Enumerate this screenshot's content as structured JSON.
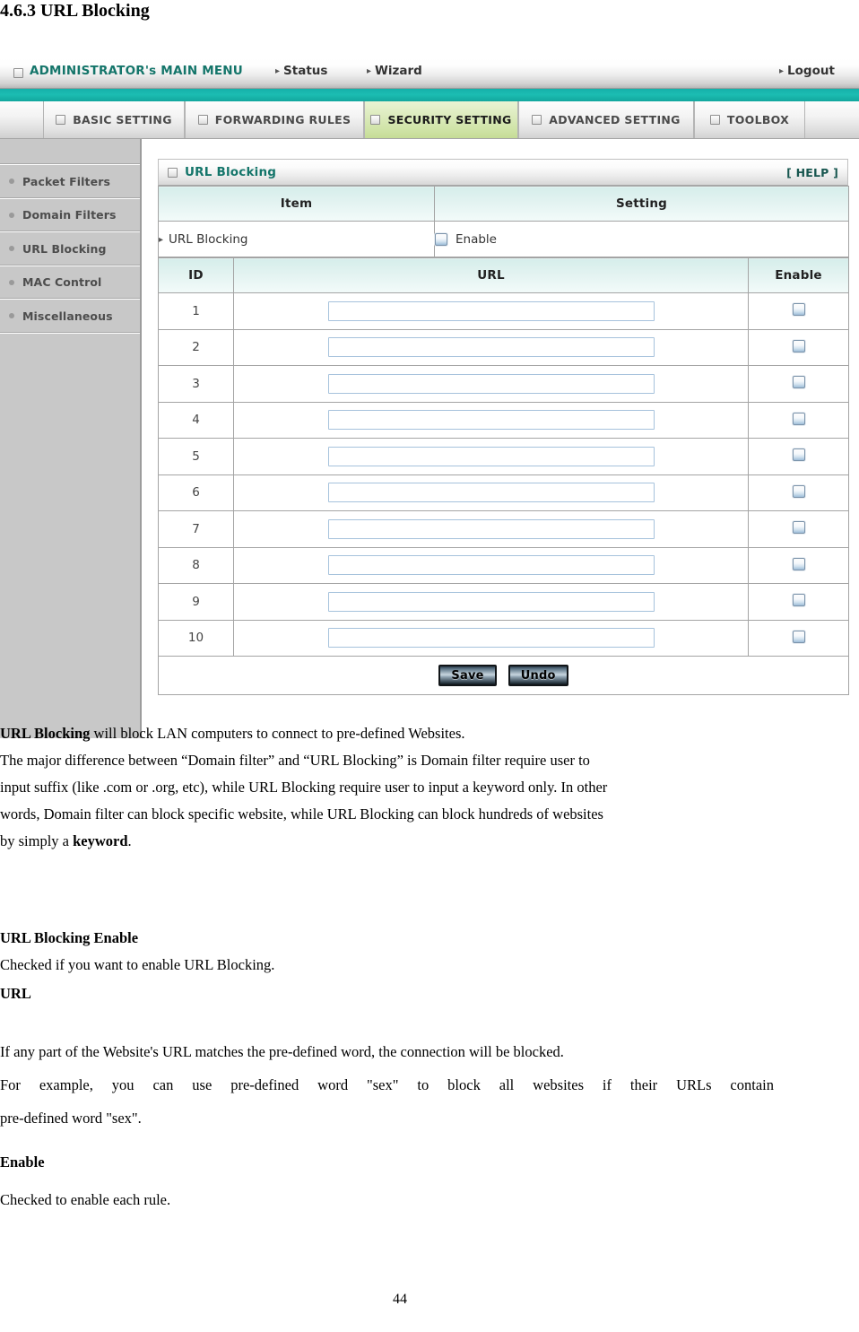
{
  "document": {
    "heading": "4.6.3 URL Blocking",
    "page_number": "44"
  },
  "router_ui": {
    "top_menu": {
      "main_menu_label": "ADMINISTRATOR's MAIN MENU",
      "links": [
        {
          "label": "Status"
        },
        {
          "label": "Wizard"
        },
        {
          "label": "Logout"
        }
      ]
    },
    "tabs": [
      {
        "label": "BASIC SETTING",
        "active": false
      },
      {
        "label": "FORWARDING RULES",
        "active": false
      },
      {
        "label": "SECURITY SETTING",
        "active": true
      },
      {
        "label": "ADVANCED SETTING",
        "active": false
      },
      {
        "label": "TOOLBOX",
        "active": false
      }
    ],
    "sidebar": {
      "items": [
        {
          "label": "Packet Filters"
        },
        {
          "label": "Domain Filters"
        },
        {
          "label": "URL Blocking"
        },
        {
          "label": "MAC Control"
        },
        {
          "label": "Miscellaneous"
        }
      ]
    },
    "panel": {
      "title": "URL Blocking",
      "help_label": "[ HELP ]",
      "columns": {
        "item": "Item",
        "setting": "Setting"
      },
      "enable_row": {
        "item_label": "URL Blocking",
        "checkbox_label": "Enable",
        "checked": false
      },
      "table_headers": {
        "id": "ID",
        "url": "URL",
        "enable": "Enable"
      },
      "rows": [
        {
          "id": "1",
          "url": "",
          "enabled": false
        },
        {
          "id": "2",
          "url": "",
          "enabled": false
        },
        {
          "id": "3",
          "url": "",
          "enabled": false
        },
        {
          "id": "4",
          "url": "",
          "enabled": false
        },
        {
          "id": "5",
          "url": "",
          "enabled": false
        },
        {
          "id": "6",
          "url": "",
          "enabled": false
        },
        {
          "id": "7",
          "url": "",
          "enabled": false
        },
        {
          "id": "8",
          "url": "",
          "enabled": false
        },
        {
          "id": "9",
          "url": "",
          "enabled": false
        },
        {
          "id": "10",
          "url": "",
          "enabled": false
        }
      ],
      "buttons": {
        "save": "Save",
        "undo": "Undo"
      }
    },
    "colors": {
      "teal_bar": "#18b3ab",
      "heading_teal": "#14756a",
      "active_tab_green": "#d4e8ad",
      "table_header_mint": "#e3f3f1",
      "input_border_blue": "#a6c2dc",
      "sidebar_gray": "#c8c8c8"
    }
  },
  "body_text": {
    "intro": {
      "bold_lead": "URL Blocking",
      "line1_rest": " will block LAN computers to connect to pre-defined Websites.",
      "line2": "The major difference between “Domain filter” and “URL Blocking” is Domain filter require user to",
      "line3": "input suffix (like .com or .org, etc), while URL Blocking require user to input a keyword only. In other",
      "line4": "words, Domain filter can block specific website, while URL Blocking can block hundreds of websites",
      "line5_pre": "by simply a ",
      "line5_bold": "keyword",
      "line5_post": "."
    },
    "sections": [
      {
        "heading": "URL Blocking Enable",
        "body": "Checked if you want to enable URL Blocking."
      },
      {
        "heading": "URL",
        "body_line1": "If any part of the Website's URL matches the pre-defined word, the connection will be blocked.",
        "body_line2": "For example, you can use pre-defined word \"sex\" to block all websites if their URLs contain",
        "body_line3": "pre-defined word \"sex\"."
      },
      {
        "heading": "Enable",
        "body": "Checked to enable each rule."
      }
    ]
  }
}
